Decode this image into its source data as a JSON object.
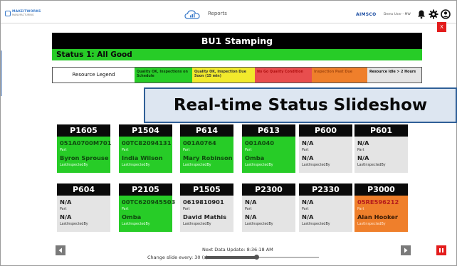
{
  "topbar": {
    "logo_line1": "MAKEITWORKS",
    "logo_line2": "MANUFACTURING",
    "reports_label": "Reports",
    "brand": "AIMSCO",
    "user": "Demo User - MW",
    "icons": [
      "bar-chart-cloud-icon",
      "bell-icon",
      "gear-icon",
      "user-icon"
    ],
    "close_label": "X"
  },
  "header": {
    "title": "BU1 Stamping",
    "status": "Status 1: All Good",
    "status_color": "#27cc27"
  },
  "legend": {
    "label": "Resource Legend",
    "items": [
      {
        "text": "Quality OK, Inspections on Schedule",
        "color": "#27cc27"
      },
      {
        "text": "Quality OK, Inspection Due Soon (15 min)",
        "color": "#f2ea2c"
      },
      {
        "text": "No Go Quality Condition",
        "color": "#e84e4e"
      },
      {
        "text": "Inspection Past Due",
        "color": "#ef7f2b"
      },
      {
        "text": "Resource Idle > 2 Hours",
        "color": "#e4e4e4"
      }
    ]
  },
  "overlay_title": "Real-time Status Slideshow",
  "tiles": [
    {
      "name": "P1605",
      "part": "051A0700M701",
      "part_label": "Part",
      "inspector": "Byron Sprouse",
      "inspector_label": "LastInspectedBy",
      "status": "green"
    },
    {
      "name": "P1504",
      "part": "00TC82094131",
      "part_label": "Part",
      "inspector": "India Wilson",
      "inspector_label": "LastInspectedBy",
      "status": "green"
    },
    {
      "name": "P614",
      "part": "001A0764",
      "part_label": "Part",
      "inspector": "Mary Robinson",
      "inspector_label": "LastInspectedBy",
      "status": "green"
    },
    {
      "name": "P613",
      "part": "001A040",
      "part_label": "Part",
      "inspector": "Omba",
      "inspector_label": "LastInspectedBy",
      "status": "green"
    },
    {
      "name": "P600",
      "part": "N/A",
      "part_label": "Part",
      "inspector": "N/A",
      "inspector_label": "LastInspectedBy",
      "status": "grey"
    },
    {
      "name": "P601",
      "part": "N/A",
      "part_label": "Part",
      "inspector": "N/A",
      "inspector_label": "LastInspectedBy",
      "status": "grey"
    },
    {
      "name": "P604",
      "part": "N/A",
      "part_label": "Part",
      "inspector": "N/A",
      "inspector_label": "LastInspectedBy",
      "status": "grey"
    },
    {
      "name": "P2105",
      "part": "00TC620945503",
      "part_label": "Part",
      "inspector": "Omba",
      "inspector_label": "LastInspectedBy",
      "status": "green"
    },
    {
      "name": "P1505",
      "part": "0619810901",
      "part_label": "Part",
      "inspector": "David Mathis",
      "inspector_label": "LastInspectedBy",
      "status": "grey"
    },
    {
      "name": "P2300",
      "part": "N/A",
      "part_label": "Part",
      "inspector": "N/A",
      "inspector_label": "LastInspectedBy",
      "status": "grey"
    },
    {
      "name": "P2330",
      "part": "N/A",
      "part_label": "Part",
      "inspector": "N/A",
      "inspector_label": "LastInspectedBy",
      "status": "grey"
    },
    {
      "name": "P3000",
      "part": "05RE596212",
      "part_label": "Part",
      "inspector": "Alan Hooker",
      "inspector_label": "LastInspectedBy",
      "status": "orange"
    }
  ],
  "footer": {
    "next_update": "Next Data Update: 8:36:18 AM",
    "change_slide": "Change slide every: 30 (s)",
    "slide_interval_fraction": 0.45,
    "prev_icon": "arrow-left-icon",
    "next_icon": "arrow-right-icon",
    "pause_icon": "pause-icon"
  }
}
